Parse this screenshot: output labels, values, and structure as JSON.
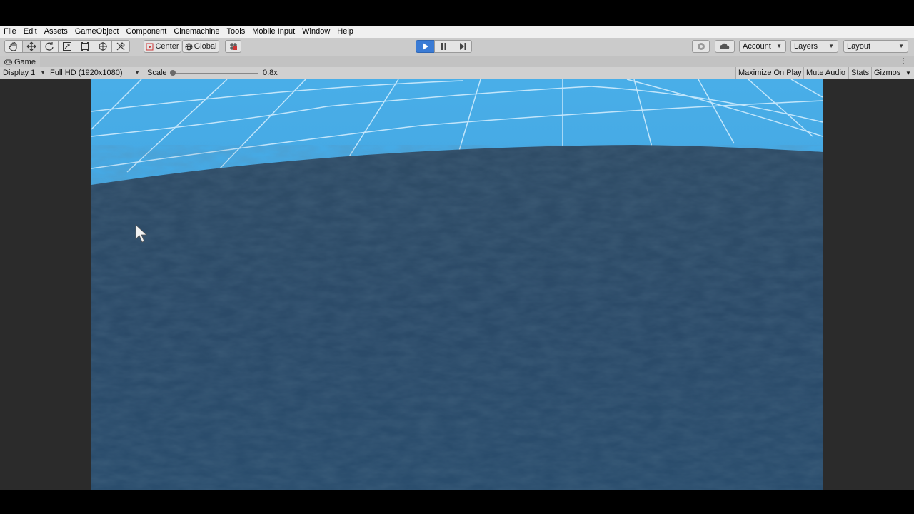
{
  "menu": [
    "File",
    "Edit",
    "Assets",
    "GameObject",
    "Component",
    "Cinemachine",
    "Tools",
    "Mobile Input",
    "Window",
    "Help"
  ],
  "toolbar": {
    "tools": [
      "hand-tool-icon",
      "move-tool-icon",
      "rotate-tool-icon",
      "scale-tool-icon",
      "rect-tool-icon",
      "transform-tool-icon",
      "custom-tool-icon"
    ],
    "pivot_mode": "Center",
    "pivot_rotation": "Global",
    "account_label": "Account",
    "layers_label": "Layers",
    "layout_label": "Layout",
    "play_active": true
  },
  "game_tab": {
    "title": "Game"
  },
  "game_bar": {
    "display": "Display 1",
    "resolution": "Full HD (1920x1080)",
    "scale_label": "Scale",
    "scale_value": "0.8x",
    "maximize_on_play": "Maximize On Play",
    "mute_audio": "Mute Audio",
    "stats": "Stats",
    "gizmos": "Gizmos"
  },
  "colors": {
    "sky": "#3fa3e0",
    "ocean": "#2c4a66",
    "play_accent": "#3a7bd5"
  }
}
